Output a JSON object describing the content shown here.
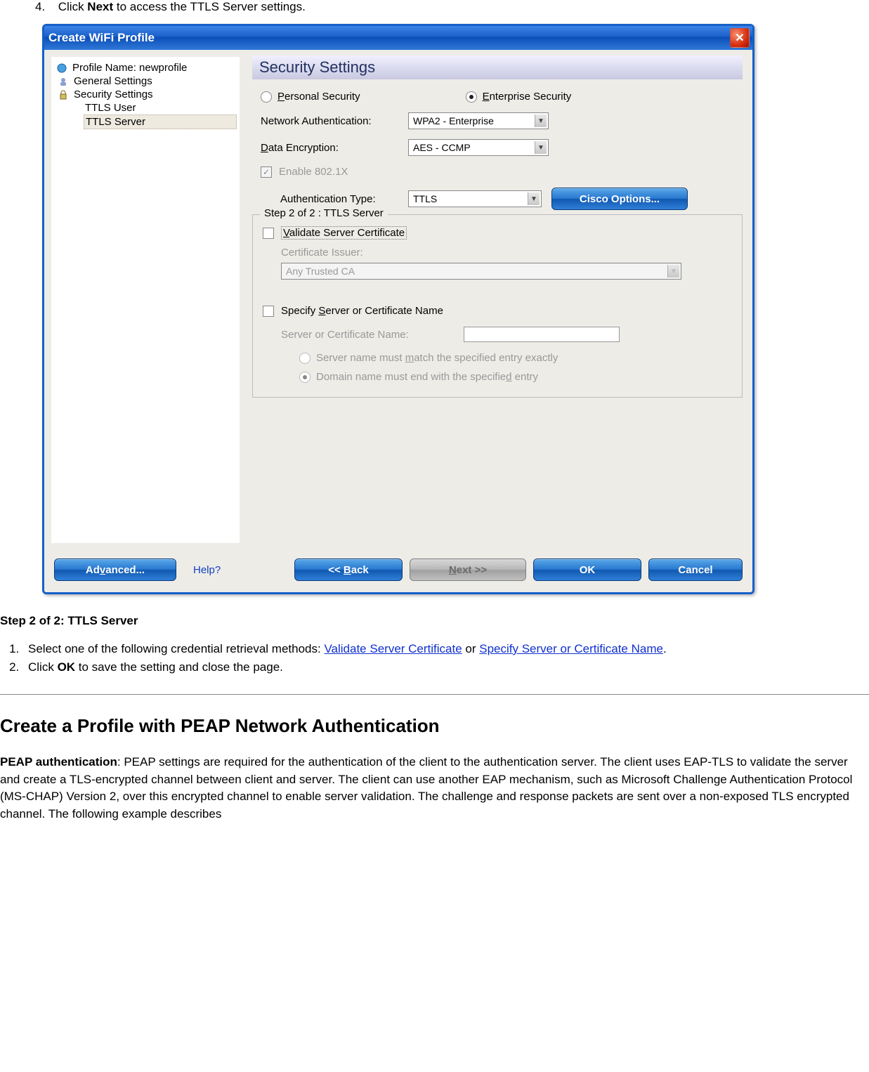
{
  "doc_step4": {
    "num": "4.",
    "prefix": "Click ",
    "bold": "Next",
    "suffix": " to access the TTLS Server settings."
  },
  "dialog": {
    "title": "Create WiFi Profile",
    "tree": {
      "profile": "Profile Name: newprofile",
      "general": "General Settings",
      "security": "Security Settings",
      "ttls_user": "TTLS User",
      "ttls_server": "TTLS Server"
    },
    "header": "Security Settings",
    "radios": {
      "personal": "Personal Security",
      "enterprise": "Enterprise Security"
    },
    "labels": {
      "net_auth": "Network Authentication:",
      "data_enc": "Data Encryption:",
      "enable_8021x": "Enable 802.1X",
      "auth_type": "Authentication Type:",
      "cert_issuer": "Certificate Issuer:",
      "server_cert_name": "Server or Certificate Name:"
    },
    "dropdowns": {
      "net_auth": "WPA2 - Enterprise",
      "data_enc": "AES - CCMP",
      "auth_type": "TTLS",
      "cert_issuer": "Any Trusted CA"
    },
    "buttons": {
      "cisco": "Cisco Options...",
      "advanced": "Advanced...",
      "help": "Help?",
      "back": "<< Back",
      "next": "Next >>",
      "ok": "OK",
      "cancel": "Cancel"
    },
    "fieldset_legend": "Step 2 of 2 : TTLS Server",
    "checkboxes": {
      "validate": "Validate Server Certificate",
      "specify": "Specify Server or Certificate Name"
    },
    "radio_opts": {
      "match": "Server name must match the specified entry exactly",
      "domain": "Domain name must end with the specified entry"
    }
  },
  "step2": {
    "heading": "Step 2 of 2: TTLS Server",
    "li1_pre": "Select one of the following credential retrieval methods: ",
    "li1_link1": "Validate Server Certificate",
    "li1_mid": " or ",
    "li1_link2": "Specify Server or Certificate Name",
    "li1_post": ".",
    "li2_pre": "Click ",
    "li2_bold": "OK",
    "li2_post": " to save the setting and close the page."
  },
  "peap": {
    "heading": "Create a Profile with PEAP Network Authentication",
    "bold_lead": "PEAP authentication",
    "body": ": PEAP settings are required for the authentication of the client to the authentication server. The client uses EAP-TLS to validate the server and create a TLS-encrypted channel between client and server. The client can use another EAP mechanism, such as Microsoft Challenge Authentication Protocol (MS-CHAP) Version 2, over this encrypted channel to enable server validation. The challenge and response packets are sent over a non-exposed TLS encrypted channel. The following example describes"
  }
}
